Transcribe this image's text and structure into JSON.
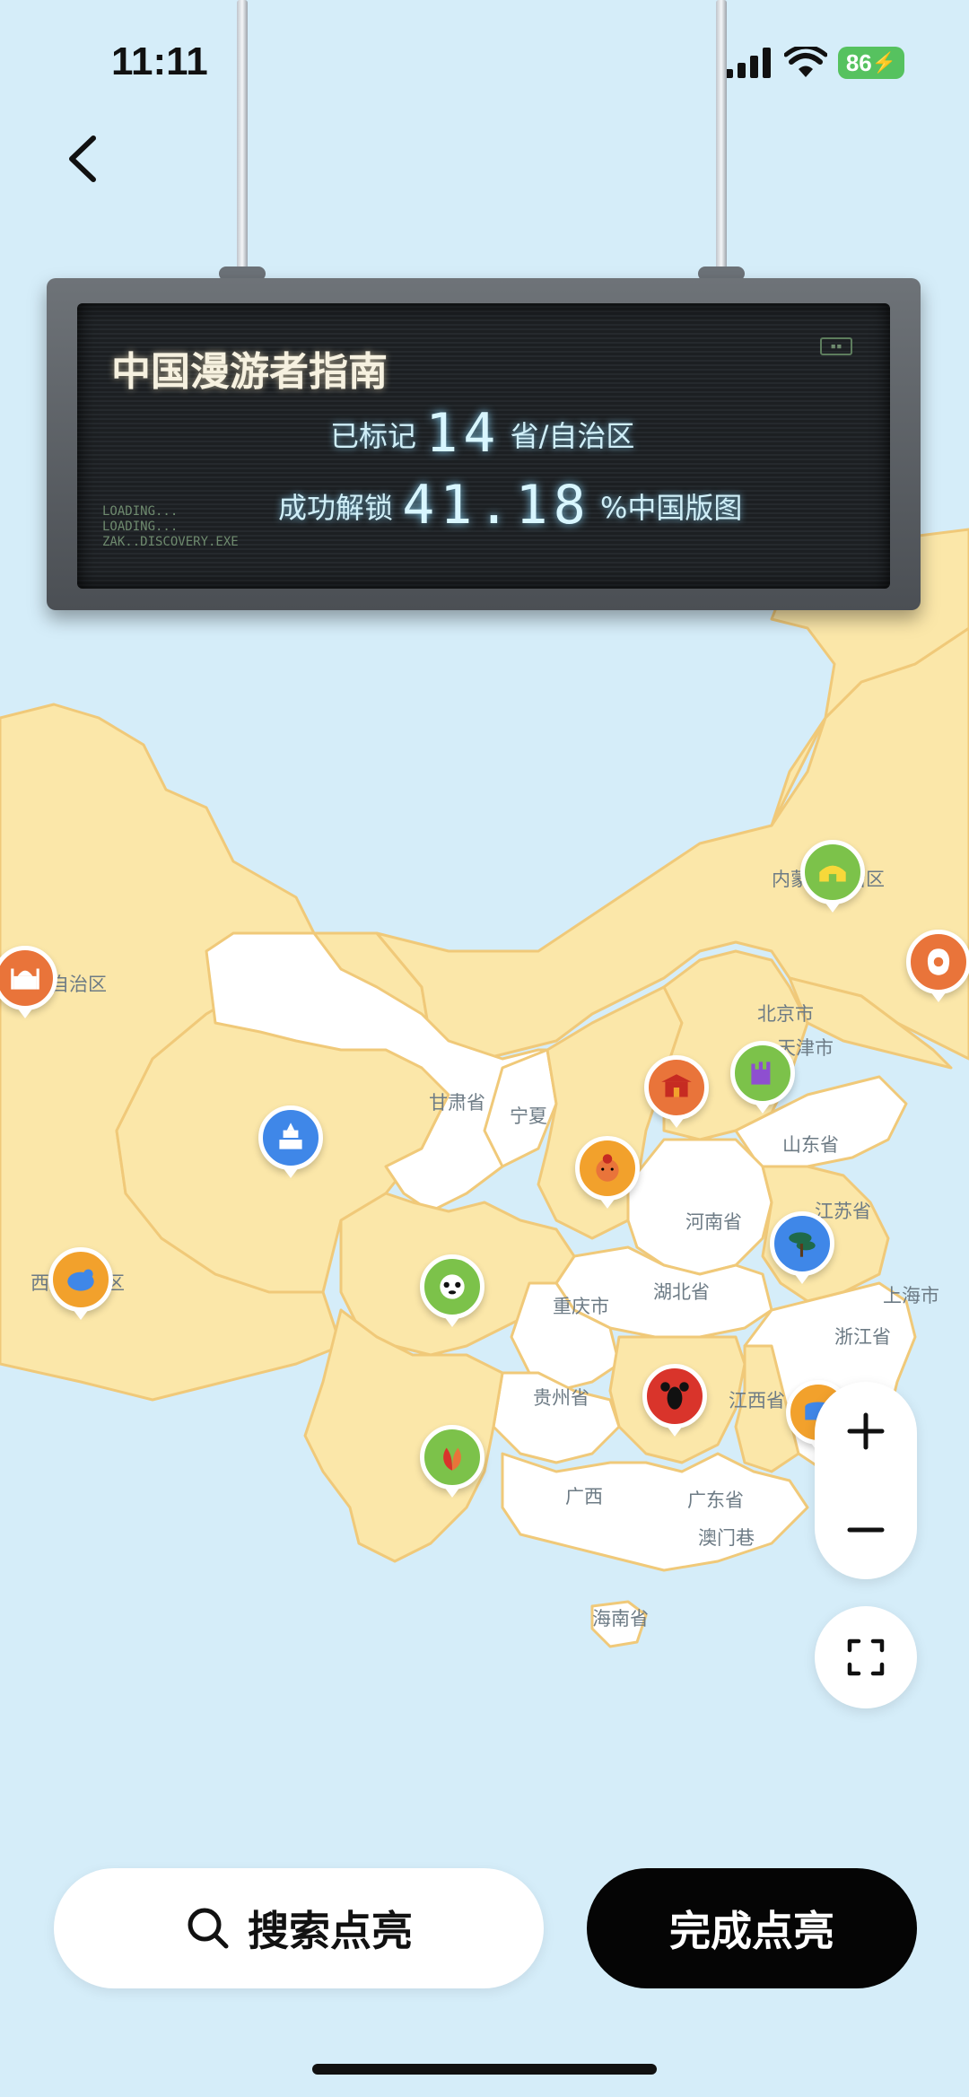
{
  "status_bar": {
    "time": "11:11",
    "battery": "86"
  },
  "board": {
    "title": "中国漫游者指南",
    "marked_prefix": "已标记",
    "marked_count": "14",
    "marked_suffix": "省/自治区",
    "unlock_prefix": "成功解锁",
    "unlock_percent": "41.18",
    "unlock_suffix": "%中国版图",
    "loading_lines": [
      "LOADING...",
      "LOADING...",
      "ZAK..DISCOVERY.EXE"
    ]
  },
  "map": {
    "labels": {
      "neimenggu": "内蒙古自治区",
      "xinjiang": "自治区",
      "beijing": "北京市",
      "tianjin": "天津市",
      "gansu": "甘肃省",
      "ningxia": "宁夏",
      "shandong": "山东省",
      "henan": "河南省",
      "jiangsu": "江苏省",
      "xizang": "西藏自治区",
      "chongqing": "重庆市",
      "hubei": "湖北省",
      "shanghai": "上海市",
      "zhejiang": "浙江省",
      "guizhou": "贵州省",
      "jiangxi": "江西省",
      "guangxi": "广西",
      "guangdong": "广东省",
      "macau": "澳门巷",
      "hainan": "海南省"
    },
    "colors": {
      "lit": "#fbe7a9",
      "unlit": "#ffffff",
      "sea": "#d5edf9",
      "border": "#f0c979"
    }
  },
  "markers": [
    {
      "name": "inner-mongolia-yurt-icon",
      "color": "#7cc24a"
    },
    {
      "name": "heilongjiang-icon",
      "color": "#e9743a"
    },
    {
      "name": "xinjiang-mosque-icon",
      "color": "#e9743a"
    },
    {
      "name": "beijing-gate-icon",
      "color": "#e9743a"
    },
    {
      "name": "hebei-wall-icon",
      "color": "#7cc24a"
    },
    {
      "name": "qinghai-temple-icon",
      "color": "#3f87e8"
    },
    {
      "name": "shaanxi-warrior-icon",
      "color": "#f2a12c"
    },
    {
      "name": "anhui-pine-icon",
      "color": "#3f87e8"
    },
    {
      "name": "tibet-yak-icon",
      "color": "#f2a12c"
    },
    {
      "name": "sichuan-panda-icon",
      "color": "#7cc24a"
    },
    {
      "name": "hunan-crayfish-icon",
      "color": "#d9342b"
    },
    {
      "name": "fujian-tulou-icon",
      "color": "#f2a12c"
    },
    {
      "name": "yunnan-peacock-icon",
      "color": "#7cc24a"
    }
  ],
  "controls": {
    "zoom_in": "+",
    "zoom_out": "−"
  },
  "actions": {
    "search": "搜索点亮",
    "done": "完成点亮"
  }
}
